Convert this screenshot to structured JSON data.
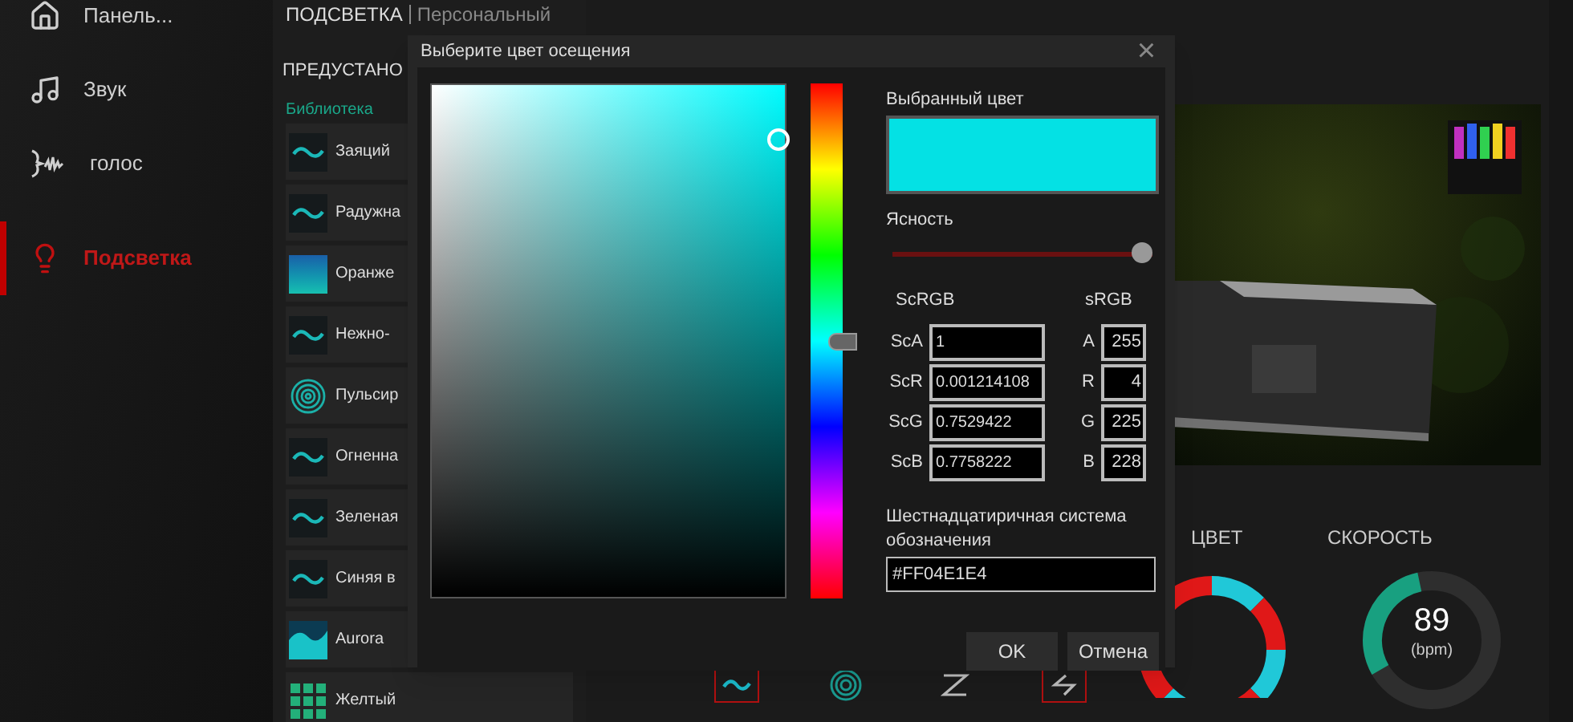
{
  "sidebar": {
    "items": [
      {
        "kind": "home",
        "label": "Панель...",
        "selected": false
      },
      {
        "kind": "music",
        "label": "Звук",
        "selected": false
      },
      {
        "kind": "voice",
        "label": "голос",
        "selected": false
      },
      {
        "kind": "light",
        "label": "Подсветка",
        "selected": true
      }
    ]
  },
  "panel": {
    "title": "ПОДСВЕТКА",
    "subtitle": "Персональный",
    "presets_title": "ПРЕДУСТАНО",
    "library_label": "Библиотека",
    "presets": [
      {
        "kind": "wave",
        "label": "Заяций"
      },
      {
        "kind": "wave",
        "label": "Радужна"
      },
      {
        "kind": "gradient",
        "label": "Оранже"
      },
      {
        "kind": "wave",
        "label": "Нежно-"
      },
      {
        "kind": "pulse",
        "label": "Пульсир"
      },
      {
        "kind": "wave",
        "label": "Огненна"
      },
      {
        "kind": "wave",
        "label": "Зеленая"
      },
      {
        "kind": "wave",
        "label": "Синяя в"
      },
      {
        "kind": "aurora",
        "label": "Aurora"
      },
      {
        "kind": "grid",
        "label": "Желтый"
      }
    ]
  },
  "controls": {
    "color_label": "ЦВЕТ",
    "speed_label": "СКОРОСТЬ",
    "speed_value": "89",
    "speed_unit": "(bpm)",
    "effects": [
      {
        "kind": "wave",
        "selected": true
      },
      {
        "kind": "pulse",
        "selected": false
      },
      {
        "kind": "zigzag",
        "selected": false
      },
      {
        "kind": "arrows",
        "selected": true
      }
    ]
  },
  "dialog": {
    "title": "Выберите цвет осещения",
    "close": "×",
    "selected_label": "Выбранный цвет",
    "brightness_label": "Ясность",
    "brightness": {
      "level": 1.0
    },
    "scrgb_label": "ScRGB",
    "srgb_label": "sRGB",
    "scrgb": [
      {
        "label": "ScA",
        "value": "1"
      },
      {
        "label": "ScR",
        "value": "0.001214108"
      },
      {
        "label": "ScG",
        "value": "0.7529422"
      },
      {
        "label": "ScB",
        "value": "0.7758222"
      }
    ],
    "srgb": [
      {
        "label": "A",
        "value": "255"
      },
      {
        "label": "R",
        "value": "4"
      },
      {
        "label": "G",
        "value": "225"
      },
      {
        "label": "B",
        "value": "228"
      }
    ],
    "hex_label": "Шестнадцатиричная система обозначения",
    "hex_value": "#FF04E1E4",
    "buttons": [
      "OK",
      "Отмена"
    ]
  }
}
